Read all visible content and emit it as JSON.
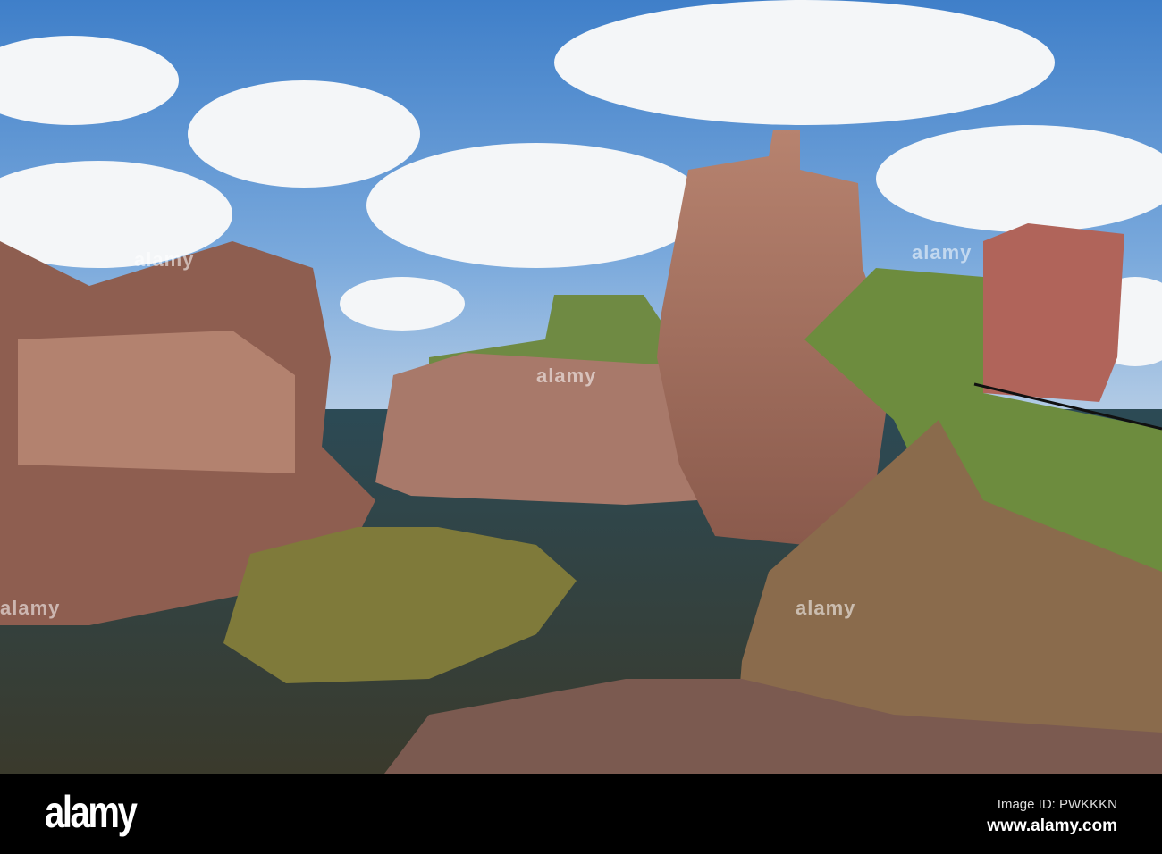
{
  "photo": {
    "subject": "Dunbar Castle ruins on red sandstone rocks by the sea",
    "watermark": "alamy"
  },
  "footer": {
    "logo": "alamy",
    "image_id": "Image ID: PWKKKN",
    "website": "www.alamy.com"
  }
}
